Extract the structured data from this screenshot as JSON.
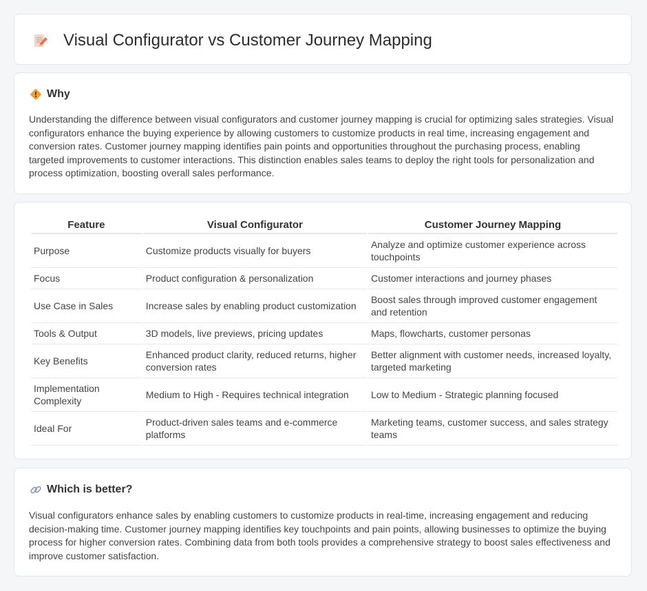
{
  "page": {
    "title": "Visual Configurator vs Customer Journey Mapping"
  },
  "icons": {
    "title": "document-pen-icon",
    "why": "diamond-sign-icon",
    "better": "link-icon"
  },
  "why": {
    "heading": "Why",
    "body": "Understanding the difference between visual configurators and customer journey mapping is crucial for optimizing sales strategies. Visual configurators enhance the buying experience by allowing customers to customize products in real time, increasing engagement and conversion rates. Customer journey mapping identifies pain points and opportunities throughout the purchasing process, enabling targeted improvements to customer interactions. This distinction enables sales teams to deploy the right tools for personalization and process optimization, boosting overall sales performance."
  },
  "table": {
    "headers": [
      "Feature",
      "Visual Configurator",
      "Customer Journey Mapping"
    ],
    "rows": [
      [
        "Purpose",
        "Customize products visually for buyers",
        "Analyze and optimize customer experience across touchpoints"
      ],
      [
        "Focus",
        "Product configuration & personalization",
        "Customer interactions and journey phases"
      ],
      [
        "Use Case in Sales",
        "Increase sales by enabling product customization",
        "Boost sales through improved customer engagement and retention"
      ],
      [
        "Tools & Output",
        "3D models, live previews, pricing updates",
        "Maps, flowcharts, customer personas"
      ],
      [
        "Key Benefits",
        "Enhanced product clarity, reduced returns, higher conversion rates",
        "Better alignment with customer needs, increased loyalty, targeted marketing"
      ],
      [
        "Implementation Complexity",
        "Medium to High - Requires technical integration",
        "Low to Medium - Strategic planning focused"
      ],
      [
        "Ideal For",
        "Product-driven sales teams and e-commerce platforms",
        "Marketing teams, customer success, and sales strategy teams"
      ]
    ]
  },
  "better": {
    "heading": "Which is better?",
    "body": "Visual configurators enhance sales by enabling customers to customize products in real-time, increasing engagement and reducing decision-making time. Customer journey mapping identifies key touchpoints and pain points, allowing businesses to optimize the buying process for higher conversion rates. Combining data from both tools provides a comprehensive strategy to boost sales effectiveness and improve customer satisfaction."
  },
  "colors": {
    "background": "#f5f6f8",
    "card": "#ffffff",
    "border": "#e3e5e8",
    "accent_orange": "#f0a030"
  }
}
